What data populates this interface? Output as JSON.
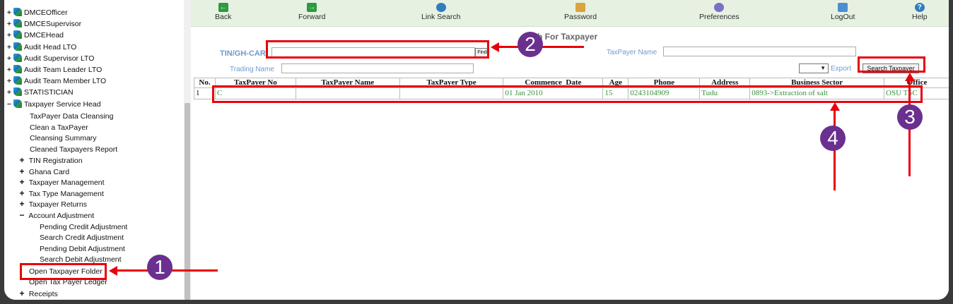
{
  "sidebar": {
    "roots": [
      {
        "label": "DMCEOfficer",
        "expander": "+"
      },
      {
        "label": "DMCESupervisor",
        "expander": "+"
      },
      {
        "label": "DMCEHead",
        "expander": "+"
      },
      {
        "label": "Audit Head LTO",
        "expander": "+"
      },
      {
        "label": "Audit Supervisor LTO",
        "expander": "+"
      },
      {
        "label": "Audit Team Leader LTO",
        "expander": "+"
      },
      {
        "label": "Audit Team Member LTO",
        "expander": "+"
      },
      {
        "label": "STATISTICIAN",
        "expander": "+"
      },
      {
        "label": "Taxpayer Service Head",
        "expander": "−"
      }
    ],
    "children": [
      "TaxPayer Data Cleansing",
      "Clean a TaxPayer",
      "Cleansing Summary",
      "Cleaned Taxpayers Report"
    ],
    "groups": [
      {
        "label": "TIN Registration",
        "pm": "+"
      },
      {
        "label": "Ghana Card",
        "pm": "+"
      },
      {
        "label": "Taxpayer Management",
        "pm": "+"
      },
      {
        "label": "Tax Type Management",
        "pm": "+"
      },
      {
        "label": "Taxpayer Returns",
        "pm": "+"
      },
      {
        "label": "Account Adjustment",
        "pm": "−"
      }
    ],
    "adjustments": [
      "Pending Credit Adjustment",
      "Search Credit Adjustment",
      "Pending Debit Adjustment",
      "Search Debit Adjustment"
    ],
    "open_folder": "Open Taxpayer Folder",
    "open_ledger": "Open Tax Payer Ledger",
    "receipts": {
      "label": "Receipts",
      "pm": "+"
    }
  },
  "toolbar": {
    "back": "Back",
    "forward": "Forward",
    "link_search": "Link Search",
    "password": "Password",
    "preferences": "Preferences",
    "logout": "LogOut",
    "help": "Help"
  },
  "form": {
    "title": "h For Taxpayer",
    "tin_label": "TIN/GH-CAR",
    "find_label": "Find",
    "taxpayer_name_label": "TaxPayer Name",
    "trading_name_label": "Trading Name",
    "export_label": "Export",
    "search_button": "Search Taxpayer"
  },
  "table": {
    "headers": [
      "No.",
      "TaxPayer No",
      "TaxPayer Name",
      "TaxPayer Type",
      "Commence_Date",
      "Age",
      "Phone",
      "Address",
      "Business Sector",
      "Office"
    ],
    "rows": [
      [
        "1",
        "C",
        "",
        "",
        "01 Jan 2010",
        "15",
        "0243104909",
        "Tudu",
        "0893->Extraction of salt",
        "OSU TSC"
      ]
    ]
  },
  "annotations": {
    "badge1": "1",
    "badge2": "2",
    "badge3": "3",
    "badge4": "4"
  },
  "colors": {
    "annotation_red": "#e8000b",
    "badge_purple": "#6b2f8f",
    "toolbar_bg": "#e6f1e2",
    "label_blue": "#6c9bd2",
    "cell_green": "#3b8f3b"
  }
}
